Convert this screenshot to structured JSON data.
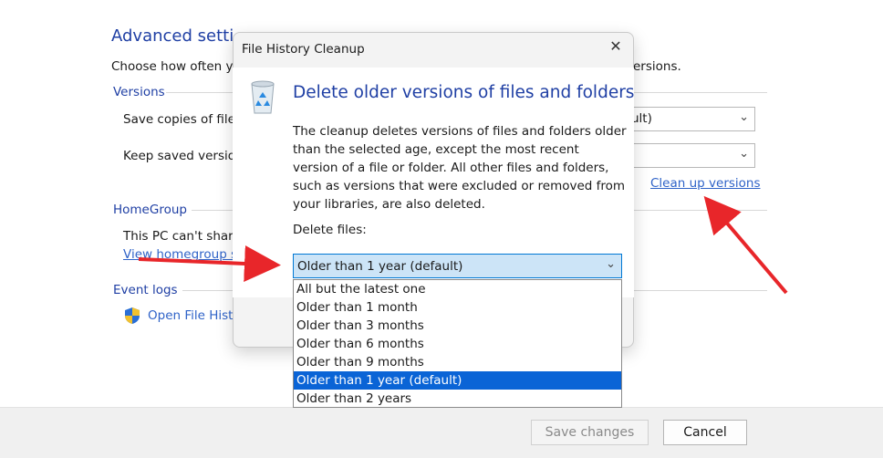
{
  "background": {
    "title": "Advanced setti",
    "description": "Choose how often y",
    "description_tail": "ersions.",
    "versions": {
      "heading": "Versions",
      "save_copies_label": "Save copies of file",
      "save_copies_value": "ult)",
      "keep_saved_label": "Keep saved versio",
      "keep_saved_value": "",
      "cleanup_link": "Clean up versions"
    },
    "homegroup": {
      "heading": "HomeGroup",
      "text": "This PC can't share",
      "link": "View homegroup s"
    },
    "event_logs": {
      "heading": "Event logs",
      "link": "Open File Hist"
    },
    "buttons": {
      "save": "Save changes",
      "cancel": "Cancel"
    }
  },
  "dialog": {
    "title": "File History Cleanup",
    "heading": "Delete older versions of files and folders",
    "description": "The cleanup deletes versions of files and folders older than the selected age, except the most recent version of a file or folder. All other files and folders, such as versions that were excluded or removed from your libraries, are also deleted.",
    "delete_files_label": "Delete files:",
    "selected_option": "Older than 1 year (default)",
    "options": [
      "All but the latest one",
      "Older than 1 month",
      "Older than 3 months",
      "Older than 6 months",
      "Older than 9 months",
      "Older than 1 year (default)",
      "Older than 2 years"
    ],
    "selected_index": 5
  },
  "icons": {
    "recycle": "recycle-bin-icon",
    "shield": "shield-icon",
    "close": "close-icon",
    "chevron": "chevron-down-icon"
  },
  "colors": {
    "accent": "#1f3fa4",
    "link": "#2f63c8",
    "highlight": "#0a64d6",
    "arrow": "#e8262a"
  }
}
